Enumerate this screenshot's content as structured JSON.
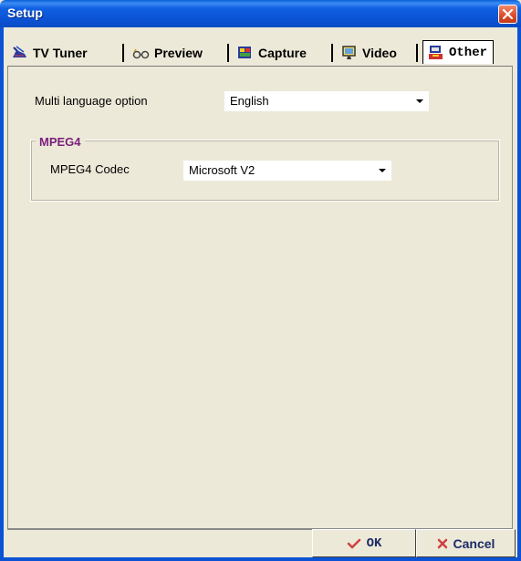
{
  "window": {
    "title": "Setup"
  },
  "tabs": [
    {
      "label": "TV Tuner",
      "icon": "tv-tuner-icon"
    },
    {
      "label": "Preview",
      "icon": "glasses-icon"
    },
    {
      "label": "Capture",
      "icon": "capture-icon"
    },
    {
      "label": "Video",
      "icon": "monitor-icon"
    },
    {
      "label": "Other",
      "icon": "other-icon",
      "active": true
    }
  ],
  "language": {
    "label": "Multi language option",
    "value": "English"
  },
  "mpeg4": {
    "group_title": "MPEG4",
    "codec_label": "MPEG4 Codec",
    "codec_value": "Microsoft V2"
  },
  "buttons": {
    "ok": "OK",
    "cancel": "Cancel"
  },
  "colors": {
    "titlebar": "#0b53d4",
    "group_title": "#7b1f7b",
    "close": "#dd4a28"
  }
}
